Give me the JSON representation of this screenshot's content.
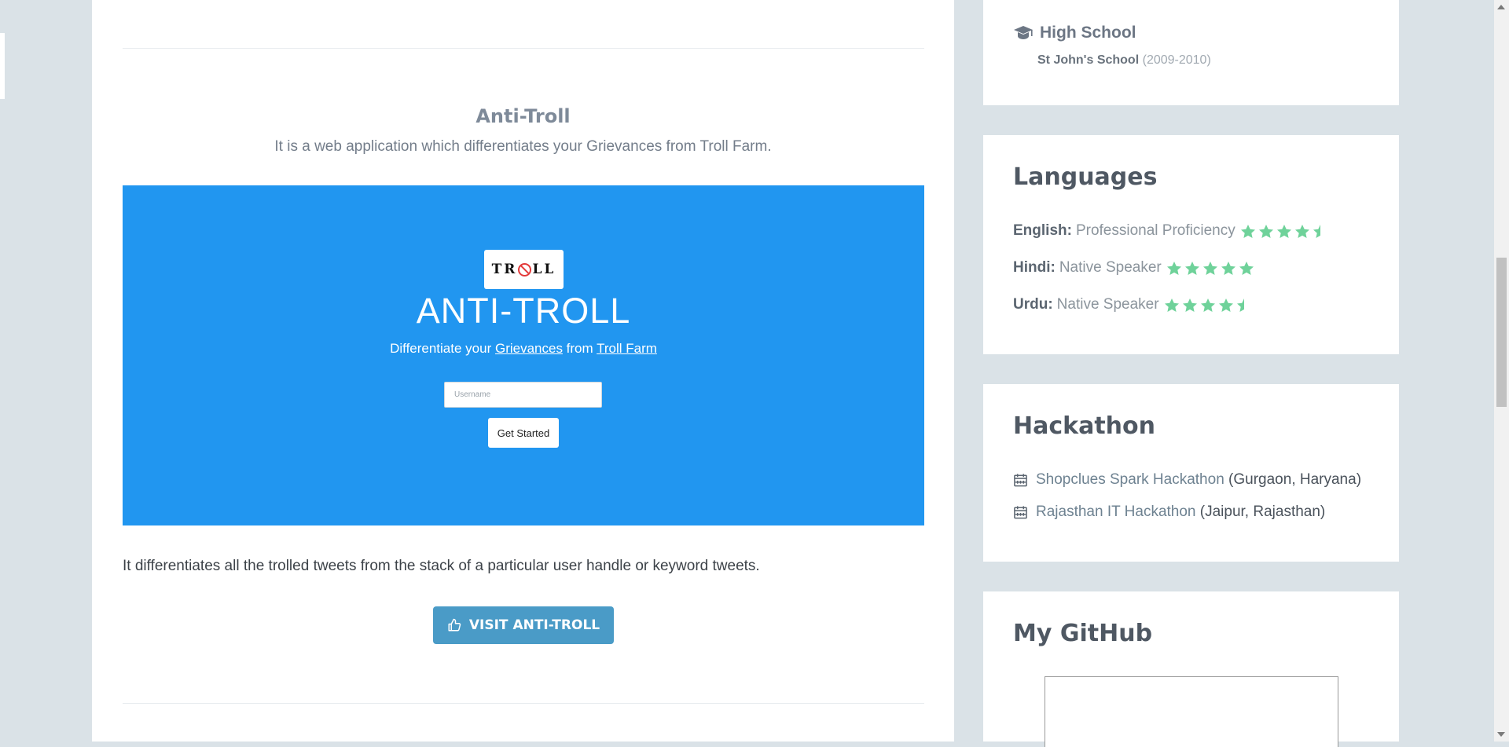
{
  "project": {
    "title": "Anti-Troll",
    "description": "It is a web application which differentiates your Grievances from Troll Farm.",
    "screenshot": {
      "logo_text_left": "TR",
      "logo_text_right": "LL",
      "heading": "ANTI-TROLL",
      "sub_prefix": "Differentiate your ",
      "sub_link1": "Grievances",
      "sub_middle": " from ",
      "sub_link2": "Troll Farm",
      "input_placeholder": "Username",
      "button_label": "Get Started",
      "background_color": "#2196f0"
    },
    "detail": "It differentiates all the trolled tweets from the stack of a particular user handle or keyword tweets.",
    "visit_label": "VISIT ANTI-TROLL",
    "visit_icon": "thumbs-up-icon"
  },
  "education": {
    "icon": "graduation-cap-icon",
    "title": "High School",
    "school": "St John's School",
    "years": "(2009-2010)"
  },
  "languages": {
    "heading": "Languages",
    "items": [
      {
        "name": "English:",
        "level": "Professional Proficiency",
        "rating": 4.5
      },
      {
        "name": "Hindi:",
        "level": "Native Speaker",
        "rating": 5
      },
      {
        "name": "Urdu:",
        "level": "Native Speaker",
        "rating": 4.5
      }
    ],
    "star_color": "#6fd29a"
  },
  "hackathon": {
    "heading": "Hackathon",
    "items": [
      {
        "name": "Shopclues Spark Hackathon",
        "location": "(Gurgaon, Haryana)",
        "icon": "calendar-icon"
      },
      {
        "name": "Rajasthan IT Hackathon",
        "location": "(Jaipur, Rajasthan)",
        "icon": "calendar-icon"
      }
    ]
  },
  "github": {
    "heading": "My GitHub"
  }
}
